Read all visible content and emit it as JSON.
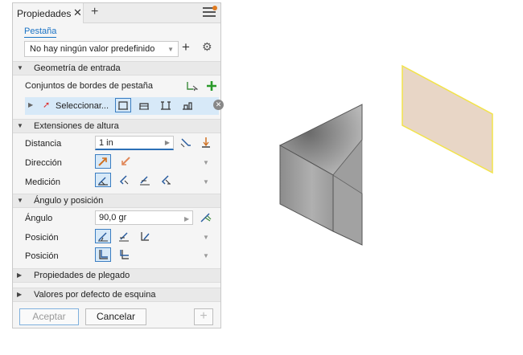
{
  "panel": {
    "tab_title": "Propiedades",
    "tab_close": "✕",
    "tab_add": "+",
    "link_label": "Pestaña",
    "preset_value": "No hay ningún valor predefinido",
    "preset_add": "+",
    "preset_gear": "⚙"
  },
  "sections": {
    "geometry": "Geometría de entrada",
    "height_ext": "Extensiones de altura",
    "angle_pos": "Ángulo y posición",
    "bend_props": "Propiedades de plegado",
    "corner_defaults": "Valores por defecto de esquina"
  },
  "geometry": {
    "edge_sets_label": "Conjuntos de bordes de pestaña",
    "select_label": "Seleccionar..."
  },
  "height": {
    "distance_label": "Distancia",
    "distance_value": "1 in",
    "direction_label": "Dirección",
    "measure_label": "Medición"
  },
  "angle": {
    "angle_label": "Ángulo",
    "angle_value": "90,0 gr",
    "position_label_1": "Posición",
    "position_label_2": "Posición"
  },
  "footer": {
    "ok_label": "Aceptar",
    "cancel_label": "Cancelar",
    "add_label": "+"
  },
  "colors": {
    "accent": "#1a73c5",
    "active_bg": "#d7e9f8",
    "face_highlight": "#e8d6c6",
    "edge_highlight": "#f2e34a"
  }
}
